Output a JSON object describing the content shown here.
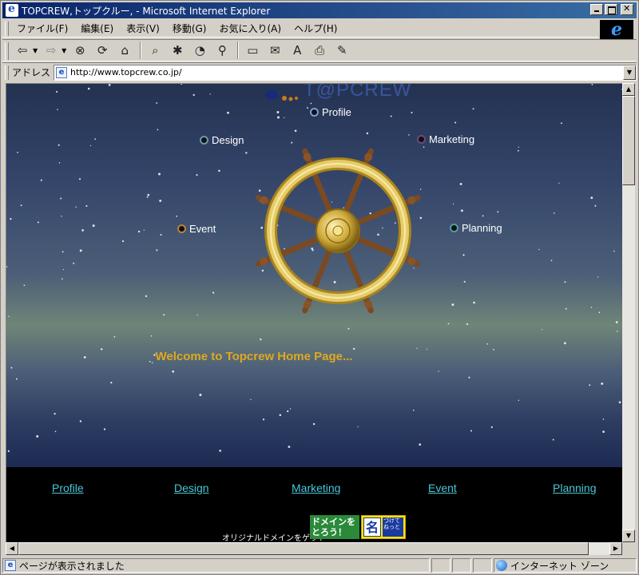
{
  "window": {
    "title": "TOPCREW,トップクルー, - Microsoft Internet Explorer"
  },
  "menu": {
    "items": [
      "ファイル(F)",
      "編集(E)",
      "表示(V)",
      "移動(G)",
      "お気に入り(A)",
      "ヘルプ(H)"
    ]
  },
  "toolbar": {
    "buttons": [
      "back-icon",
      "forward-icon",
      "stop-icon",
      "refresh-icon",
      "home-icon",
      "search-icon",
      "favorites-icon",
      "history-icon",
      "channels-icon",
      "fullscreen-icon",
      "mail-icon",
      "font-icon",
      "print-icon",
      "edit-icon"
    ]
  },
  "address": {
    "label": "アドレス",
    "url": "http://www.topcrew.co.jp/"
  },
  "page": {
    "logo_text": "T@PCREW",
    "wheel_nav": {
      "profile": "Profile",
      "design": "Design",
      "marketing": "Marketing",
      "event": "Event",
      "planning": "Planning"
    },
    "welcome": "Welcome to Topcrew Home Page...",
    "footer_links": [
      "Profile",
      "Design",
      "Marketing",
      "Event",
      "Planning"
    ],
    "banner": {
      "caption": "オリジナルドメインをゲット",
      "domain_text": "ドメインを とろう！",
      "name_big": "名",
      "name_small": "づけて ねっと"
    }
  },
  "status": {
    "text": "ページが表示されました",
    "zone": "インターネット ゾーン"
  },
  "colors": {
    "titlebar": "#0a246a",
    "welcome": "#e0a820",
    "footer_link": "#48c8d8"
  }
}
